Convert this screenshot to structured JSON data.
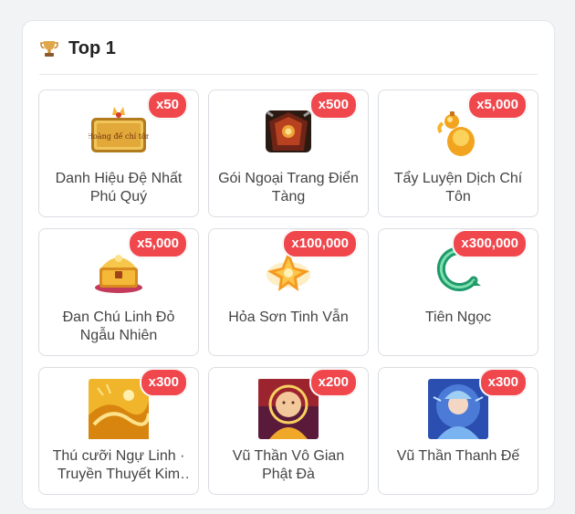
{
  "section": {
    "title": "Top 1",
    "icon": "trophy-icon"
  },
  "rewards": [
    {
      "name": "Danh Hiệu Đệ Nhất Phú Quý",
      "qty": "x50",
      "icon": "title-plaque-icon",
      "plaque_text": "Hoàng đế chí tôn"
    },
    {
      "name": "Gói Ngoại Trang Điển Tàng",
      "qty": "x500",
      "icon": "treasure-chest-icon"
    },
    {
      "name": "Tẩy Luyện Dịch Chí Tôn",
      "qty": "x5,000",
      "icon": "gold-gourd-icon"
    },
    {
      "name": "Đan Chú Linh Đỏ Ngẫu Nhiên",
      "qty": "x5,000",
      "icon": "gold-chest-icon"
    },
    {
      "name": "Hỏa Sơn Tinh Vẫn",
      "qty": "x100,000",
      "icon": "fire-crystal-icon"
    },
    {
      "name": "Tiên Ngọc",
      "qty": "x300,000",
      "icon": "jade-dragon-icon"
    },
    {
      "name": "Thú cưỡi Ngự Linh · Truyền Thuyết Kim Long",
      "qty": "x300",
      "icon": "golden-mount-icon"
    },
    {
      "name": "Vũ Thần Vô Gian Phật Đà",
      "qty": "x200",
      "icon": "buddha-portrait-icon"
    },
    {
      "name": "Vũ Thần Thanh Đế",
      "qty": "x300",
      "icon": "blue-deity-portrait-icon"
    }
  ],
  "colors": {
    "badge": "#f0474d",
    "text": "#444444",
    "card_border": "#dadde2"
  }
}
